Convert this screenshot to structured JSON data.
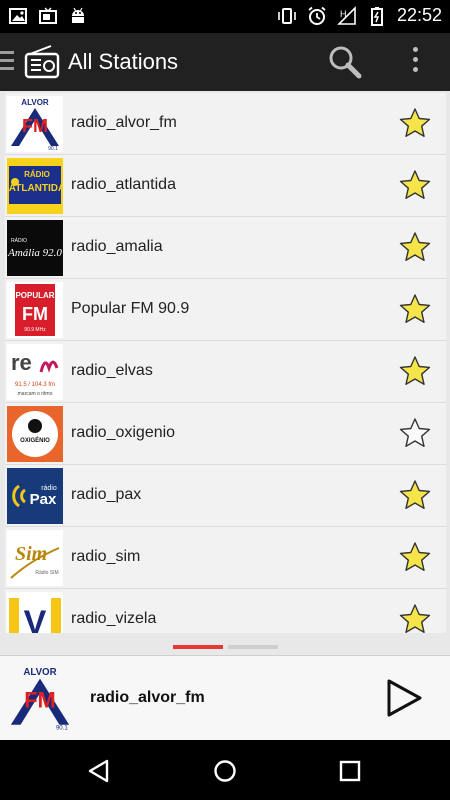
{
  "status_bar": {
    "time": "22:52",
    "left_icons": [
      "image-icon",
      "tv-icon",
      "android-icon"
    ],
    "right_icons": [
      "vibrate-icon",
      "alarm-icon",
      "signal-icon",
      "battery-icon"
    ]
  },
  "app_bar": {
    "title": "All Stations",
    "icons": [
      "drawer-icon",
      "radio-icon",
      "search-icon",
      "overflow-menu-icon"
    ]
  },
  "stations": [
    {
      "name": "radio_alvor_fm",
      "logo": "alvor-fm-logo",
      "favorite": true
    },
    {
      "name": "radio_atlantida",
      "logo": "radio-atlantida-logo",
      "favorite": true
    },
    {
      "name": "radio_amalia",
      "logo": "amalia-logo",
      "favorite": true
    },
    {
      "name": "Popular FM 90.9",
      "logo": "popular-fm-logo",
      "favorite": true
    },
    {
      "name": "radio_elvas",
      "logo": "radio-elvas-logo",
      "favorite": true
    },
    {
      "name": "radio_oxigenio",
      "logo": "oxigenio-logo",
      "favorite": false
    },
    {
      "name": "radio_pax",
      "logo": "radio-pax-logo",
      "favorite": true
    },
    {
      "name": "radio_sim",
      "logo": "radio-sim-logo",
      "favorite": true
    },
    {
      "name": "radio_vizela",
      "logo": "radio-vizela-logo",
      "favorite": true
    }
  ],
  "logo_text": {
    "alvor_top": "ALVOR",
    "alvor_main": "FM",
    "alvor_freq": "90.1",
    "atlantida_top": "RÁDIO",
    "atlantida_main": "ATLANTIDA",
    "amalia_top": "RÁDIO",
    "amalia_main": "Amália 92.0",
    "popular_top": "POPULAR",
    "popular_main": "FM",
    "popular_freq": "90.9 MHz",
    "elvas_main": "re",
    "elvas_freq": "91.5 / 104.3 fm",
    "elvas_slogan": "marcam o ritmo",
    "oxigenio_main": "OXIGÉNIO",
    "pax_top": "rádio",
    "pax_main": "Pax",
    "sim_main": "Sim",
    "sim_slogan": "Rádio SIM",
    "vizela_main": "V"
  },
  "pager": {
    "pages": 2,
    "active_index": 0
  },
  "player": {
    "station_name": "radio_alvor_fm",
    "logo": "alvor-fm-logo",
    "state_icon": "play-icon"
  },
  "nav_bar": {
    "icons": [
      "back-icon",
      "home-icon",
      "recents-icon"
    ]
  },
  "colors": {
    "status_bar": "#000000",
    "app_bar": "#212121",
    "list_background": "#f2f2f2",
    "star_fill": "#f5e54a",
    "pager_active": "#e53935",
    "pager_inactive": "#cfcfcf"
  }
}
